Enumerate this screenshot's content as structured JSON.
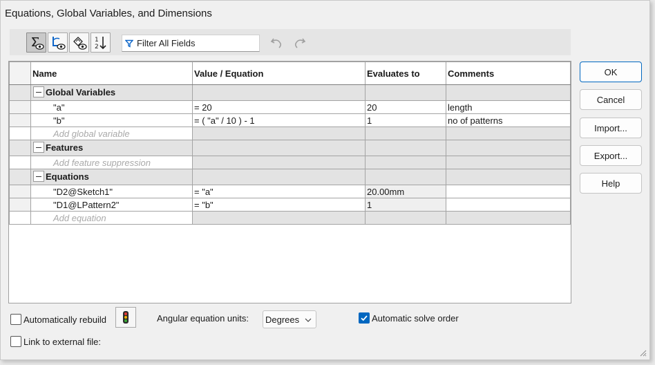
{
  "window": {
    "title": "Equations, Global Variables, and Dimensions"
  },
  "toolbar": {
    "buttons": [
      {
        "icon": "equation-view-icon",
        "active": true
      },
      {
        "icon": "sketch-equation-view-icon",
        "active": false
      },
      {
        "icon": "dimension-view-icon",
        "active": false
      },
      {
        "icon": "ordered-view-icon",
        "active": false
      }
    ],
    "filter_placeholder": "Filter All Fields",
    "undo_icon": "undo-icon",
    "redo_icon": "redo-icon"
  },
  "table": {
    "columns": [
      "Name",
      "Value / Equation",
      "Evaluates to",
      "Comments"
    ],
    "sections": {
      "global": {
        "label": "Global Variables",
        "rows": [
          {
            "name": "\"a\"",
            "value": "= 20",
            "evaluates": "20",
            "comment": "length"
          },
          {
            "name": "\"b\"",
            "value": "= ( \"a\" / 10 ) - 1",
            "evaluates": "1",
            "comment": "no of patterns"
          }
        ],
        "add_placeholder": "Add global variable"
      },
      "features": {
        "label": "Features",
        "add_placeholder": "Add feature suppression"
      },
      "equations": {
        "label": "Equations",
        "rows": [
          {
            "name": "\"D2@Sketch1\"",
            "value": "= \"a\"",
            "evaluates": "20.00mm",
            "comment": ""
          },
          {
            "name": "\"D1@LPattern2\"",
            "value": "= \"b\"",
            "evaluates": "1",
            "comment": ""
          }
        ],
        "add_placeholder": "Add equation"
      }
    }
  },
  "buttons": {
    "ok": "OK",
    "cancel": "Cancel",
    "import": "Import...",
    "export": "Export...",
    "help": "Help"
  },
  "bottom": {
    "auto_rebuild_label": "Automatically rebuild",
    "auto_rebuild_checked": false,
    "angular_units_label": "Angular equation units:",
    "angular_units_value": "Degrees",
    "auto_solve_label": "Automatic solve order",
    "auto_solve_checked": true,
    "link_external_label": "Link to external file:",
    "link_external_checked": false
  },
  "colors": {
    "accent": "#0067c0",
    "section_bg": "#e3e3e3"
  }
}
